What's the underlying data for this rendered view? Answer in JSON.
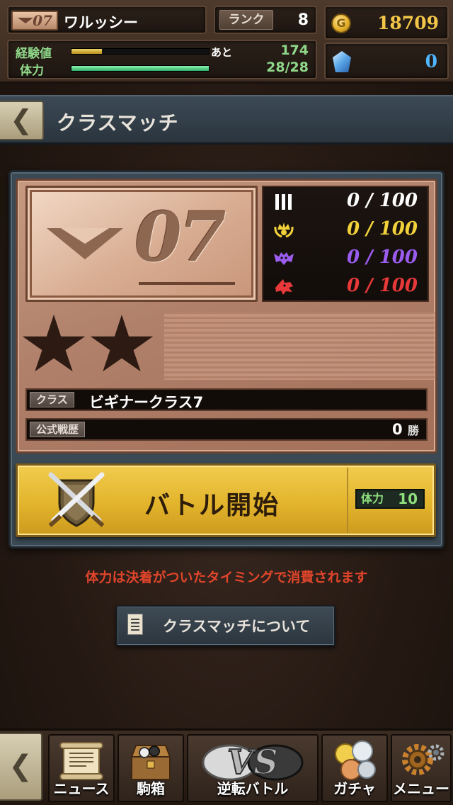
{
  "player": {
    "rank_emblem": "07",
    "name": "ワルッシー",
    "rank_label": "ランク",
    "rank_value": "8",
    "exp_label": "経験値",
    "exp_remaining_label": "あと",
    "exp_remaining": "174",
    "exp_fill": 0.22,
    "stamina_label": "体力",
    "stamina_value": "28/28",
    "stamina_fill": 1.0
  },
  "currency": {
    "gold_icon_letter": "G",
    "gold": "18709",
    "gems": "0"
  },
  "header": {
    "back_icon": "chevron-left-icon",
    "title": "クラスマッチ"
  },
  "class_card": {
    "emblem_number": "07",
    "scores": [
      {
        "icon": "roman-three-icon",
        "value": "0",
        "max": "100",
        "color": "#ffffff"
      },
      {
        "icon": "crown-laurel-icon",
        "value": "0",
        "max": "100",
        "color": "#f2d23a"
      },
      {
        "icon": "demon-bat-icon",
        "value": "0",
        "max": "100",
        "color": "#9b5cf0"
      },
      {
        "icon": "dragon-head-icon",
        "value": "0",
        "max": "100",
        "color": "#e8393a"
      }
    ],
    "stars": 2,
    "class_tag": "クラス",
    "class_name": "ビギナークラス7",
    "record_tag": "公式戦歴",
    "wins": "0",
    "wins_unit": "勝"
  },
  "battle": {
    "label": "バトル開始",
    "cost_label": "体力",
    "cost_value": "10"
  },
  "notice": "体力は決着がついたタイミングで消費されます",
  "about_button": "クラスマッチについて",
  "nav": {
    "back_icon": "chevron-left-icon",
    "items": [
      {
        "label": "ニュース",
        "icon": "scroll-icon"
      },
      {
        "label": "駒箱",
        "icon": "treasure-chest-icon"
      },
      {
        "label": "逆転バトル",
        "icon": "vs-icon",
        "vs_text": "VS"
      },
      {
        "label": "ガチャ",
        "icon": "coins-icon"
      },
      {
        "label": "メニュー",
        "icon": "gear-icon"
      }
    ]
  }
}
